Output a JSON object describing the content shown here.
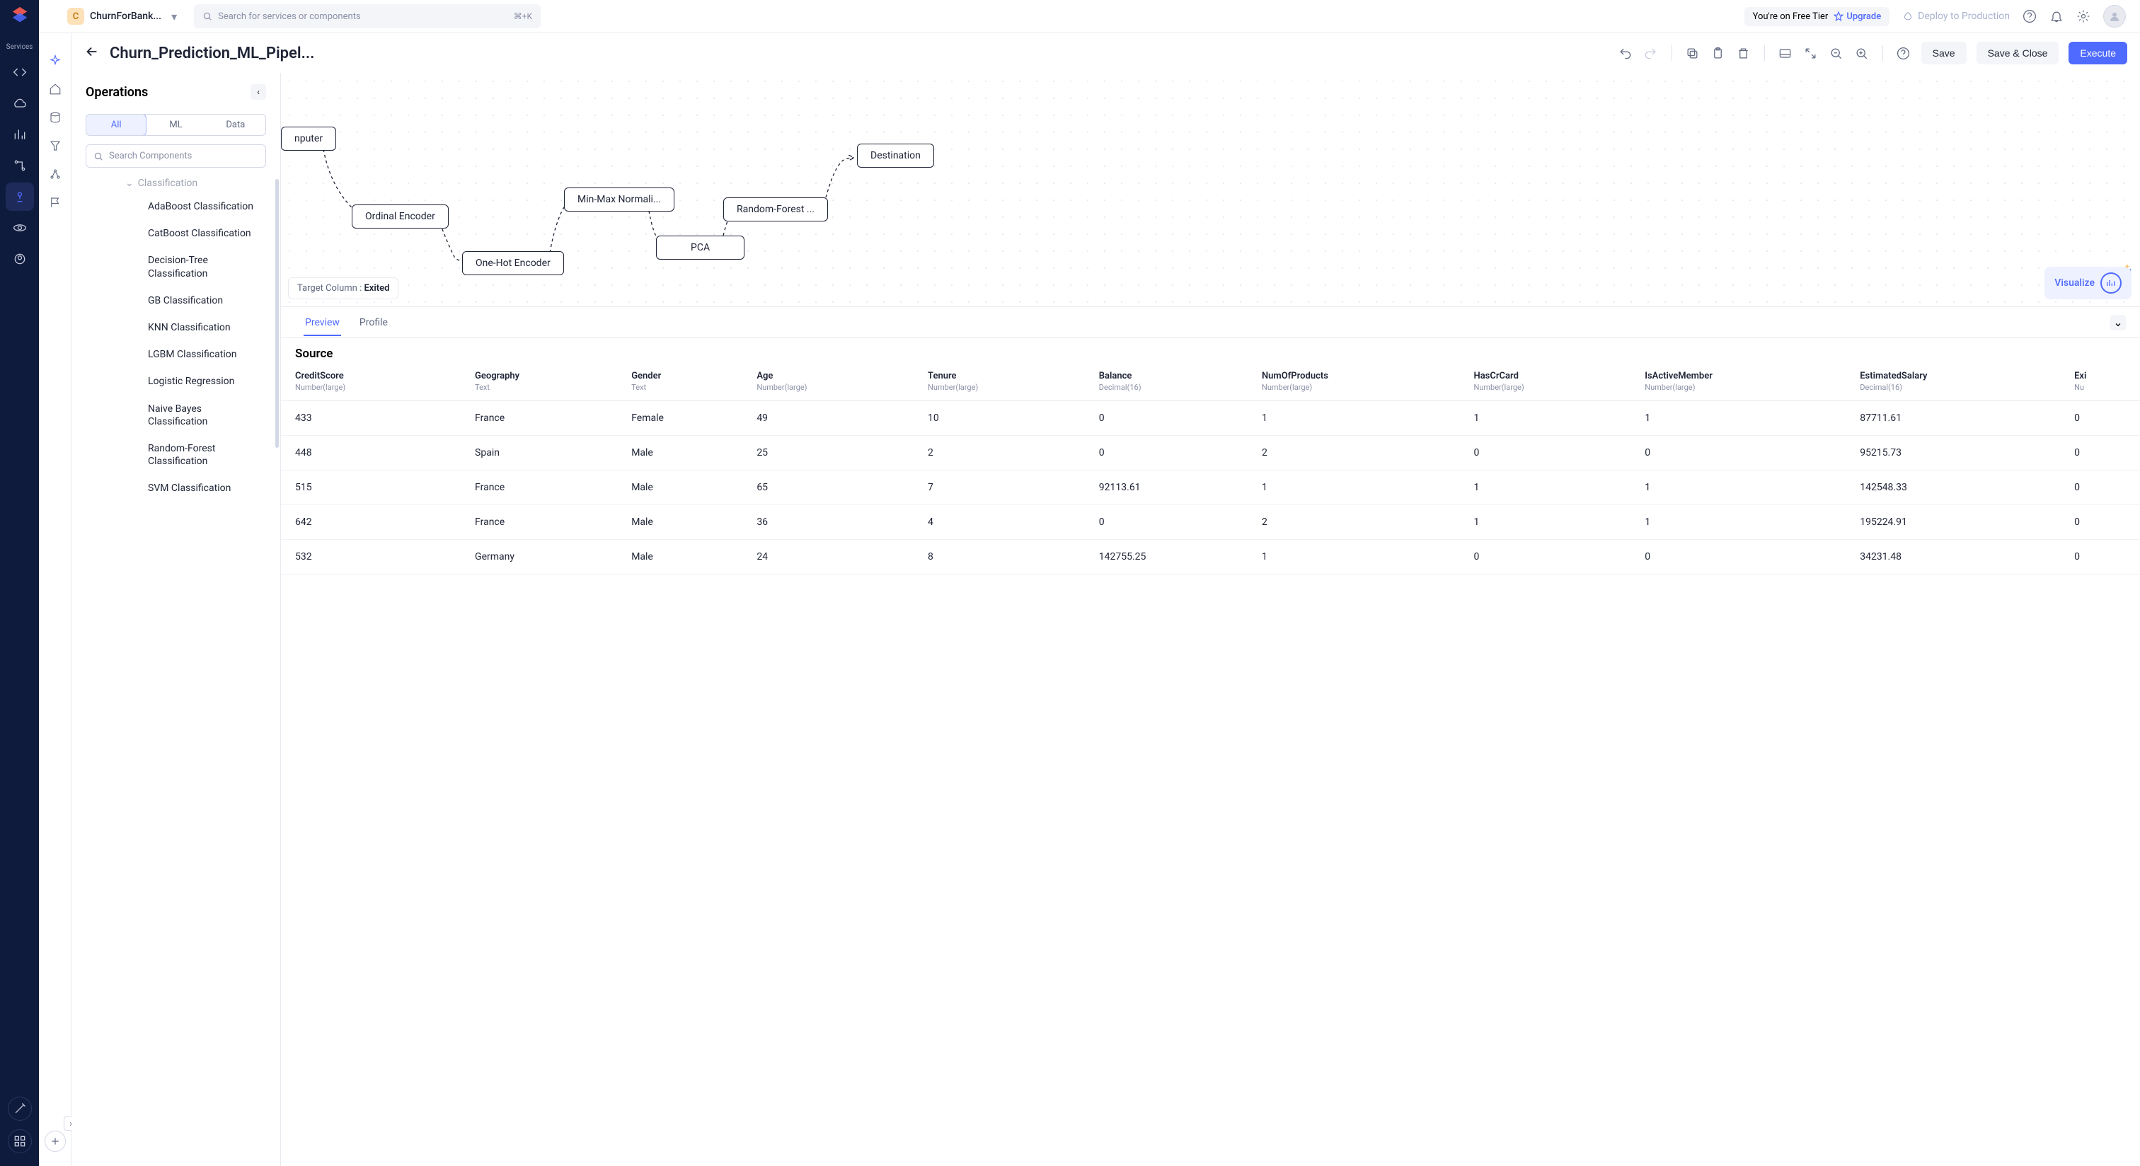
{
  "topbar": {
    "project_badge": "C",
    "project_name": "ChurnForBank...",
    "search_placeholder": "Search for services or components",
    "shortcut": "⌘+K",
    "tier_text": "You're on Free Tier",
    "upgrade": "Upgrade",
    "deploy": "Deploy to Production"
  },
  "header": {
    "title": "Churn_Prediction_ML_Pipel...",
    "save": "Save",
    "save_close": "Save & Close",
    "execute": "Execute"
  },
  "ops": {
    "title": "Operations",
    "tabs": {
      "all": "All",
      "ml": "ML",
      "data": "Data"
    },
    "search_placeholder": "Search Components",
    "category": "Classification",
    "items": [
      "AdaBoost Classification",
      "CatBoost Classification",
      "Decision-Tree Classification",
      "GB Classification",
      "KNN Classification",
      "LGBM Classification",
      "Logistic Regression",
      "Naive Bayes Classification",
      "Random-Forest Classification",
      "SVM Classification"
    ]
  },
  "canvas": {
    "nodes": {
      "imputer": "nputer",
      "ordinal": "Ordinal Encoder",
      "onehot": "One-Hot Encoder",
      "minmax": "Min-Max Normali...",
      "pca": "PCA",
      "rf": "Random-Forest ...",
      "dest": "Destination"
    },
    "target_label": "Target Column :",
    "target_value": "Exited",
    "visualize": "Visualize"
  },
  "table": {
    "tabs": {
      "preview": "Preview",
      "profile": "Profile"
    },
    "source": "Source",
    "columns": [
      {
        "name": "CreditScore",
        "type": "Number(large)"
      },
      {
        "name": "Geography",
        "type": "Text"
      },
      {
        "name": "Gender",
        "type": "Text"
      },
      {
        "name": "Age",
        "type": "Number(large)"
      },
      {
        "name": "Tenure",
        "type": "Number(large)"
      },
      {
        "name": "Balance",
        "type": "Decimal(16)"
      },
      {
        "name": "NumOfProducts",
        "type": "Number(large)"
      },
      {
        "name": "HasCrCard",
        "type": "Number(large)"
      },
      {
        "name": "IsActiveMember",
        "type": "Number(large)"
      },
      {
        "name": "EstimatedSalary",
        "type": "Decimal(16)"
      },
      {
        "name": "Exi",
        "type": "Nu"
      }
    ],
    "rows": [
      [
        "433",
        "France",
        "Female",
        "49",
        "10",
        "0",
        "1",
        "1",
        "1",
        "87711.61",
        "0"
      ],
      [
        "448",
        "Spain",
        "Male",
        "25",
        "2",
        "0",
        "2",
        "0",
        "0",
        "95215.73",
        "0"
      ],
      [
        "515",
        "France",
        "Male",
        "65",
        "7",
        "92113.61",
        "1",
        "1",
        "1",
        "142548.33",
        "0"
      ],
      [
        "642",
        "France",
        "Male",
        "36",
        "4",
        "0",
        "2",
        "1",
        "1",
        "195224.91",
        "0"
      ],
      [
        "532",
        "Germany",
        "Male",
        "24",
        "8",
        "142755.25",
        "1",
        "0",
        "0",
        "34231.48",
        "0"
      ]
    ]
  }
}
